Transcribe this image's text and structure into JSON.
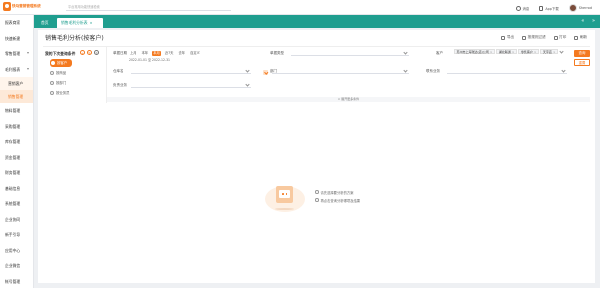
{
  "app": {
    "logo_text": "快马营销管理系统",
    "logo_sub": "kuaima",
    "search_placeholder": "平台常用功能快速检索"
  },
  "top_actions": [
    {
      "label": "消息",
      "icon": "chat-icon"
    },
    {
      "label": "App下载",
      "icon": "phone-icon"
    },
    {
      "label": "Sherrod",
      "icon": "avatar"
    }
  ],
  "sidebar": {
    "items": [
      {
        "label": "报表商家"
      },
      {
        "label": "快速新建"
      },
      {
        "label": "零售管理",
        "caret": true
      },
      {
        "label": "毛利报表",
        "caret": true
      },
      {
        "label": "营销客户",
        "sub": true
      },
      {
        "label": "销售管理",
        "sub": true,
        "active": true
      },
      {
        "label": "物料管理"
      },
      {
        "label": "采购管理"
      },
      {
        "label": "库存管理"
      },
      {
        "label": "资金管理"
      },
      {
        "label": "财务管理"
      },
      {
        "label": "基础信息"
      },
      {
        "label": "系统管理"
      },
      {
        "label": "企业协同"
      },
      {
        "label": "新手引导"
      },
      {
        "label": "应用中心"
      },
      {
        "label": "企业微信"
      },
      {
        "label": "帐号管理"
      }
    ]
  },
  "tabs": {
    "home": "首页",
    "current": "销售毛利分析表",
    "close": "×",
    "strip_icons": [
      "«",
      "»"
    ]
  },
  "page": {
    "title": "销售毛利分析(按客户)",
    "toolbar": [
      {
        "label": "导出",
        "icon": "export-icon"
      },
      {
        "label": "按规则过滤",
        "icon": "filter-icon"
      },
      {
        "label": "打印",
        "icon": "print-icon"
      },
      {
        "label": "刷新",
        "icon": "refresh-icon"
      }
    ]
  },
  "quick_filter": {
    "title": "我的下次查询条件",
    "icons": [
      "+",
      "✎",
      "✕"
    ],
    "items": [
      {
        "label": "按客户",
        "active": true
      },
      {
        "label": "按商品"
      },
      {
        "label": "按部门"
      },
      {
        "label": "按业务员"
      }
    ]
  },
  "filters": {
    "period_label": "单据日期",
    "period_options": [
      "上月",
      "本年",
      "本月",
      "近7天",
      "去年",
      "自定义"
    ],
    "period_active_index": 2,
    "date_range": "2022-01-01 至 2022-12-31",
    "doc_type_label": "单据类型",
    "customer_label": "客户",
    "customer_chips": [
      "苏州市上海瑞达(店)公司",
      "湖北联通",
      "零售客户",
      "天宇店"
    ],
    "warehouse_label": "仓库名",
    "department_label": "部门",
    "contact_label": "联系业务",
    "salesperson_label": "负责业务",
    "expand_label": "∨ 展开更多条件",
    "query_button": "查询",
    "reset_button": "重置"
  },
  "empty_state": {
    "lines": [
      "请先选择要分析的方案",
      "再点击查询分析哪项及结果"
    ]
  }
}
